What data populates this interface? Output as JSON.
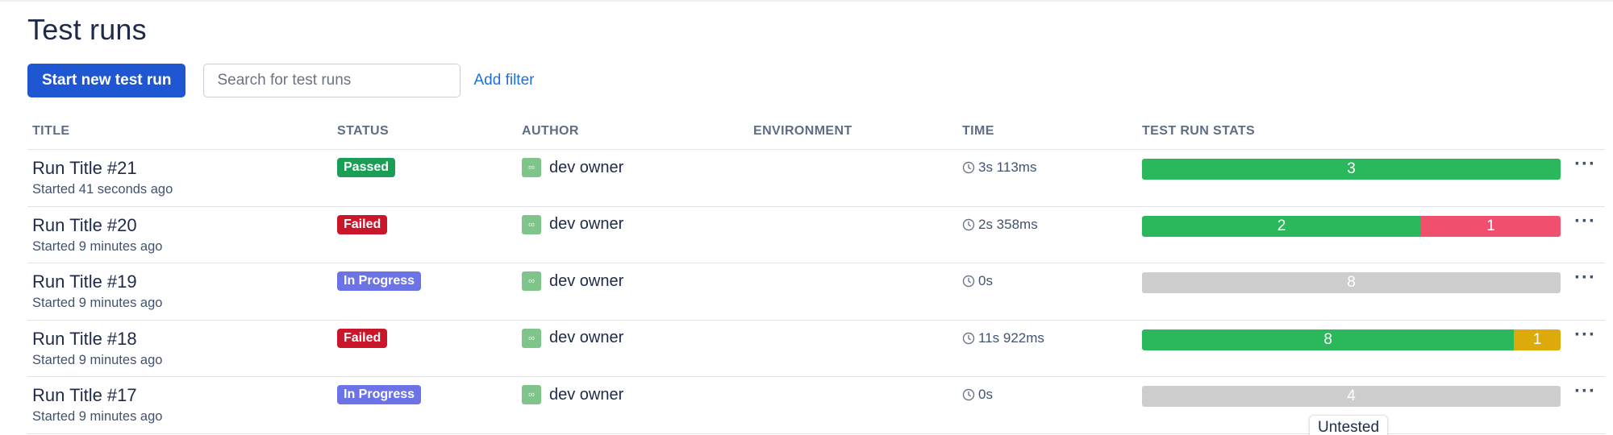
{
  "page": {
    "title": "Test runs"
  },
  "toolbar": {
    "start_button": "Start new test run",
    "search_placeholder": "Search for test runs",
    "search_value": "",
    "add_filter": "Add filter"
  },
  "table": {
    "headers": [
      "TITLE",
      "STATUS",
      "AUTHOR",
      "ENVIRONMENT",
      "TIME",
      "TEST RUN STATS"
    ],
    "rows": [
      {
        "title": "Run Title #21",
        "started": "Started 41 seconds ago",
        "status": "Passed",
        "author": "dev owner",
        "environment": "",
        "time": "3s 113ms",
        "stats": [
          {
            "label": "3",
            "value": 3,
            "color": "#2bb75b"
          }
        ]
      },
      {
        "title": "Run Title #20",
        "started": "Started 9 minutes ago",
        "status": "Failed",
        "author": "dev owner",
        "environment": "",
        "time": "2s 358ms",
        "stats": [
          {
            "label": "2",
            "value": 2,
            "color": "#2bb75b"
          },
          {
            "label": "1",
            "value": 1,
            "color": "#f0506e"
          }
        ]
      },
      {
        "title": "Run Title #19",
        "started": "Started 9 minutes ago",
        "status": "In Progress",
        "author": "dev owner",
        "environment": "",
        "time": "0s",
        "stats": [
          {
            "label": "8",
            "value": 8,
            "color": "#cdcdcd"
          }
        ]
      },
      {
        "title": "Run Title #18",
        "started": "Started 9 minutes ago",
        "status": "Failed",
        "author": "dev owner",
        "environment": "",
        "time": "11s 922ms",
        "stats": [
          {
            "label": "8",
            "value": 8,
            "color": "#2bb75b"
          },
          {
            "label": "1",
            "value": 1,
            "color": "#dcaa0b"
          }
        ]
      },
      {
        "title": "Run Title #17",
        "started": "Started 9 minutes ago",
        "status": "In Progress",
        "author": "dev owner",
        "environment": "",
        "time": "0s",
        "stats": [
          {
            "label": "4",
            "value": 4,
            "color": "#cdcdcd"
          }
        ]
      }
    ]
  },
  "status_colors": {
    "Passed": "#1a9e55",
    "Failed": "#c9162b",
    "In Progress": "#6b73e6"
  },
  "icons": {
    "avatar": "infinity-avatar-icon",
    "time": "clock-icon",
    "more": "more-horizontal-icon"
  },
  "tooltip": {
    "text": "Untested"
  }
}
